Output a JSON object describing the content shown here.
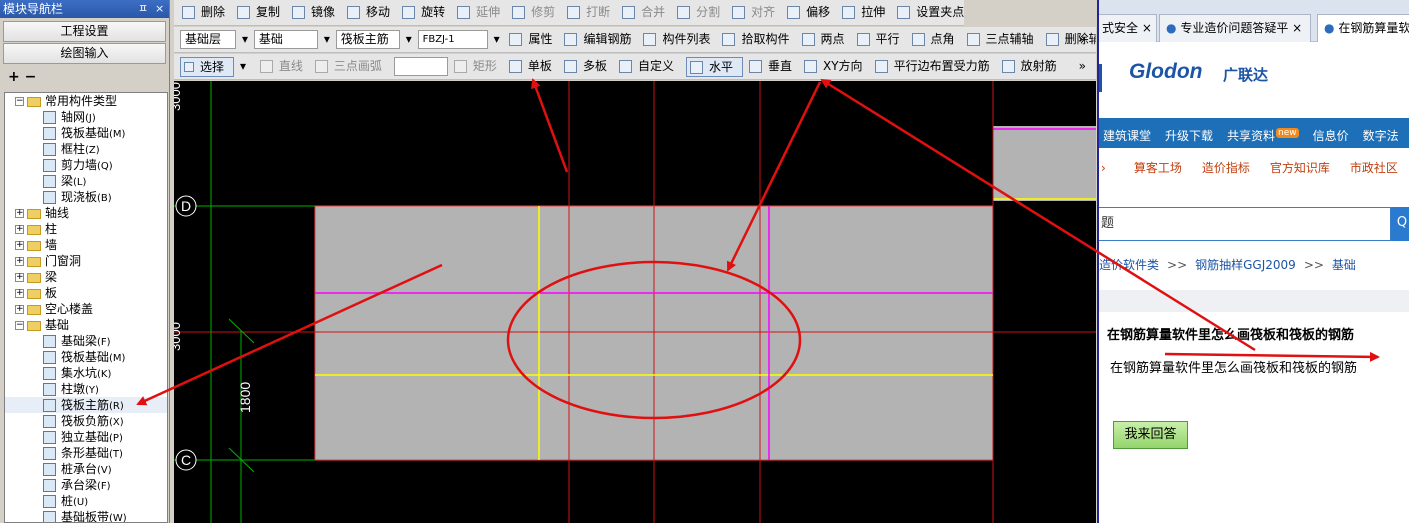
{
  "nav": {
    "title": "模块导航栏",
    "pin": "ㅍ",
    "close": "×",
    "btn_project": "工程设置",
    "btn_draw": "绘图输入",
    "tools": "+  −",
    "tree": [
      {
        "label": "常用构件类型",
        "toggle": "−",
        "kind": "folder",
        "level": 0
      },
      {
        "label": "轴网",
        "code": "(J)",
        "kind": "item",
        "level": 1
      },
      {
        "label": "筏板基础",
        "code": "(M)",
        "kind": "item",
        "level": 1
      },
      {
        "label": "框柱",
        "code": "(Z)",
        "kind": "item",
        "level": 1
      },
      {
        "label": "剪力墙",
        "code": "(Q)",
        "kind": "item",
        "level": 1
      },
      {
        "label": "梁",
        "code": "(L)",
        "kind": "item",
        "level": 1
      },
      {
        "label": "现浇板",
        "code": "(B)",
        "kind": "item",
        "level": 1
      },
      {
        "label": "轴线",
        "toggle": "+",
        "kind": "folder",
        "level": 0
      },
      {
        "label": "柱",
        "toggle": "+",
        "kind": "folder",
        "level": 0
      },
      {
        "label": "墙",
        "toggle": "+",
        "kind": "folder",
        "level": 0
      },
      {
        "label": "门窗洞",
        "toggle": "+",
        "kind": "folder",
        "level": 0
      },
      {
        "label": "梁",
        "toggle": "+",
        "kind": "folder",
        "level": 0
      },
      {
        "label": "板",
        "toggle": "+",
        "kind": "folder",
        "level": 0
      },
      {
        "label": "空心楼盖",
        "toggle": "+",
        "kind": "folder",
        "level": 0
      },
      {
        "label": "基础",
        "toggle": "−",
        "kind": "folder",
        "level": 0
      },
      {
        "label": "基础梁",
        "code": "(F)",
        "kind": "item",
        "level": 1
      },
      {
        "label": "筏板基础",
        "code": "(M)",
        "kind": "item",
        "level": 1
      },
      {
        "label": "集水坑",
        "code": "(K)",
        "kind": "item",
        "level": 1
      },
      {
        "label": "柱墩",
        "code": "(Y)",
        "kind": "item",
        "level": 1
      },
      {
        "label": "筏板主筋",
        "code": "(R)",
        "kind": "item",
        "level": 1
      },
      {
        "label": "筏板负筋",
        "code": "(X)",
        "kind": "item",
        "level": 1
      },
      {
        "label": "独立基础",
        "code": "(P)",
        "kind": "item",
        "level": 1
      },
      {
        "label": "条形基础",
        "code": "(T)",
        "kind": "item",
        "level": 1
      },
      {
        "label": "桩承台",
        "code": "(V)",
        "kind": "item",
        "level": 1
      },
      {
        "label": "承台梁",
        "code": "(F)",
        "kind": "item",
        "level": 1
      },
      {
        "label": "桩",
        "code": "(U)",
        "kind": "item",
        "level": 1
      },
      {
        "label": "基础板带",
        "code": "(W)",
        "kind": "item",
        "level": 1
      }
    ]
  },
  "toolbar1": [
    "删除",
    "复制",
    "镜像",
    "移动",
    "旋转",
    "延伸",
    "修剪",
    "打断",
    "合并",
    "分割",
    "对齐",
    "偏移",
    "拉伸",
    "设置夹点"
  ],
  "toolbar2": {
    "layer": "基础层",
    "category": "基础",
    "type": "筏板主筋",
    "name": "FBZJ-1",
    "buttons": [
      "属性",
      "编辑钢筋",
      "构件列表",
      "拾取构件",
      "两点",
      "平行",
      "点角",
      "三点辅轴",
      "删除辅轴"
    ],
    "more": "»"
  },
  "toolbar3": {
    "select": "选择",
    "buttons_disabled": [
      "直线",
      "三点画弧",
      "矩形"
    ],
    "buttons": [
      "单板",
      "多板",
      "自定义",
      "水平",
      "垂直",
      "XY方向",
      "平行边布置受力筋",
      "放射筋"
    ],
    "more": "»"
  },
  "canvas": {
    "axis_d": "D",
    "axis_c": "C",
    "dim_left_1": "3000",
    "dim_left_2": "3000",
    "dim_1800": "1800"
  },
  "browser": {
    "tabs": [
      "式安全",
      "专业造价问题答疑平",
      "在钢筋算量软"
    ],
    "tab_close": "×",
    "logo_en": "Glodon",
    "logo_cn": "广联达",
    "menu1": [
      "建筑课堂",
      "升级下载",
      "共享资料",
      "信息价",
      "数字法"
    ],
    "new_badge": "new",
    "menu2": [
      "算客工场",
      "造价指标",
      "官方知识库",
      "市政社区"
    ],
    "search_prefix": "题",
    "crumb": [
      "造价软件类",
      "钢筋抽样GGJ2009",
      "基础"
    ],
    "crumb_sep": ">>",
    "question_title": "在钢筋算量软件里怎么画筏板和筏板的钢筋",
    "question_body": "在钢筋算量软件里怎么画筏板和筏板的钢筋",
    "answer_button": "我来回答"
  },
  "colors": {
    "annotation_red": "#e01010",
    "nav_title": "#2a58a8",
    "slab_gray": "#b3b3b3",
    "rebar_magenta": "#ff00ff",
    "rebar_yellow": "#ffff00",
    "grid_green": "#00c000",
    "browser_menu": "#1d6fb8"
  }
}
